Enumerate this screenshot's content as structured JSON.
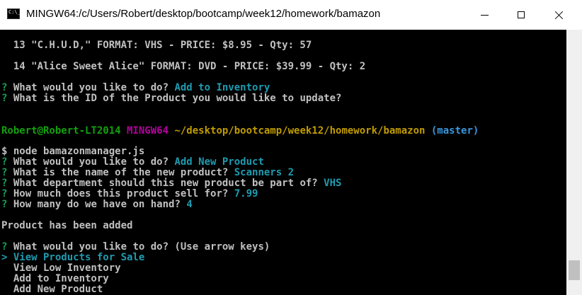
{
  "window": {
    "title": "MINGW64:/c/Users/Robert/desktop/bootcamp/week12/homework/bamazon",
    "icon_label": "C:\\_"
  },
  "terminal": {
    "product13": "  13 \"C.H.U.D,\" FORMAT: VHS - PRICE: $8.95 - Qty: 57",
    "product14": "  14 \"Alice Sweet Alice\" FORMAT: DVD - PRICE: $39.99 - Qty: 2",
    "q_mark": "?",
    "q_action1": " What would you like to do? ",
    "a_action1": "Add to Inventory",
    "q_id": " What is the ID of the Product you would like to update?",
    "prompt_user": "Robert@Robert-LT2014",
    "prompt_host": " MINGW64",
    "prompt_path": " ~/desktop/bootcamp/week12/homework/bamazon",
    "prompt_branch": " (master)",
    "command": "$ node bamazonmanager.js",
    "q_action2": " What would you like to do? ",
    "a_action2": "Add New Product",
    "q_name": " What is the name of the new product? ",
    "a_name": "Scanners 2",
    "q_dept": " What department should this new product be part of? ",
    "a_dept": "VHS",
    "q_price": " How much does this product sell for? ",
    "a_price": "7.99",
    "q_qty": " How many do we have on hand? ",
    "a_qty": "4",
    "added_msg": "Product has been added",
    "q_action3": " What would you like to do? (Use arrow keys)",
    "menu": [
      "> View Products for Sale",
      "  View Low Inventory",
      "  Add to Inventory",
      "  Add New Product"
    ]
  },
  "colors": {
    "background": "#000000",
    "text": "#c0c0c0",
    "question_mark": "#14a05a",
    "answer": "#1f9bb0",
    "prompt_user": "#13a10e",
    "prompt_host": "#b4009e",
    "prompt_path": "#c19c00",
    "prompt_branch": "#3a96dd"
  }
}
